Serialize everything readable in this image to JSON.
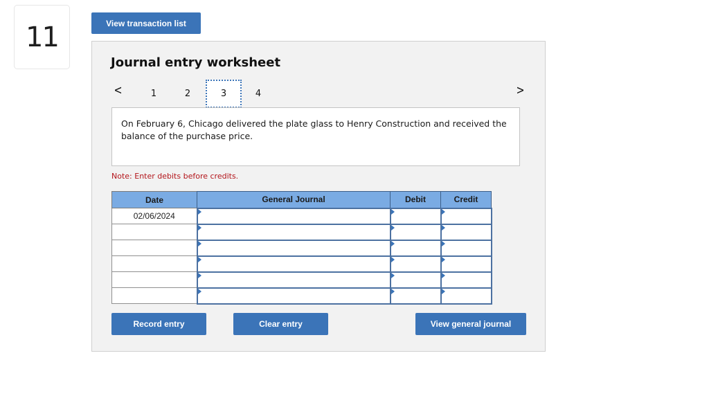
{
  "question_number": "11",
  "toolbar": {
    "view_transaction_list": "View transaction list"
  },
  "worksheet": {
    "title": "Journal entry worksheet",
    "pager": {
      "prev_icon": "chevron-left-icon",
      "next_icon": "chevron-right-icon",
      "pages": [
        "1",
        "2",
        "3",
        "4"
      ],
      "current_page": "3"
    },
    "description": "On February 6, Chicago delivered the plate glass to Henry Construction and received the balance of the purchase price.",
    "note": "Note: Enter debits before credits.",
    "table": {
      "headers": {
        "date": "Date",
        "general_journal": "General Journal",
        "debit": "Debit",
        "credit": "Credit"
      },
      "rows": [
        {
          "date": "02/06/2024",
          "account": "",
          "debit": "",
          "credit": ""
        },
        {
          "date": "",
          "account": "",
          "debit": "",
          "credit": ""
        },
        {
          "date": "",
          "account": "",
          "debit": "",
          "credit": ""
        },
        {
          "date": "",
          "account": "",
          "debit": "",
          "credit": ""
        },
        {
          "date": "",
          "account": "",
          "debit": "",
          "credit": ""
        },
        {
          "date": "",
          "account": "",
          "debit": "",
          "credit": ""
        }
      ]
    },
    "buttons": {
      "record_entry": "Record entry",
      "clear_entry": "Clear entry",
      "view_general_journal": "View general journal"
    }
  },
  "colors": {
    "button_blue": "#3b74b8",
    "header_blue": "#7aabe3",
    "note_red": "#b3141a",
    "panel_bg": "#f2f2f2"
  }
}
